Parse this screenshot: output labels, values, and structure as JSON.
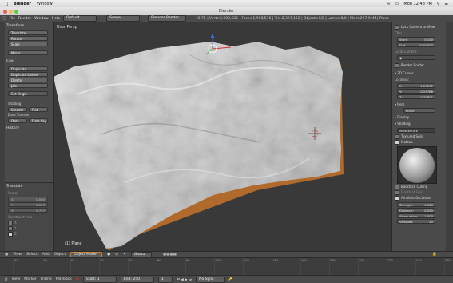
{
  "macbar": {
    "app": "Blender",
    "menu": "Window",
    "clock": "Mon 12:48 PM"
  },
  "window": {
    "title": "Blender"
  },
  "header": {
    "menus": [
      "File",
      "Render",
      "Window",
      "Help"
    ],
    "layout": "Default",
    "scene": "Scene",
    "engine": "Blender Render",
    "stats": "v2.75 | Verts:2,003,626 | Faces:1,998,576 | Tris:2,397,152 | Objects:0/2 | Lamps:0/0 | Mem:297.94M | Plane"
  },
  "toolshelf": {
    "transform_title": "Transform",
    "transform_buttons": [
      "Translate",
      "Rotate",
      "Scale",
      "Mirror"
    ],
    "edit_title": "Edit",
    "edit_buttons": [
      "Duplicate",
      "Duplicate Linked",
      "Delete",
      "Join"
    ],
    "set_origin": "Set Origin",
    "shading_title": "Shading",
    "smooth": "Smooth",
    "flat": "Flat",
    "data_transfer": "Data Transfer",
    "data": "Data",
    "data_lay": "Data Lay",
    "history_title": "History",
    "op_title": "Translate",
    "vector_label": "Vector",
    "vector": [
      {
        "axis": "X",
        "value": "0.000"
      },
      {
        "axis": "Y",
        "value": "0.000"
      },
      {
        "axis": "Z",
        "value": "0.737"
      }
    ],
    "constraint_label": "Constraint Axis",
    "constraints": [
      "X",
      "Y",
      "Z"
    ]
  },
  "viewport": {
    "label": "User Persp",
    "object": "(1) Plane"
  },
  "props": {
    "lock_camera": "Lock Camera to View",
    "clip_title": "Clip:",
    "clip_start_label": "Start:",
    "clip_start": "0.100",
    "clip_end_label": "End:",
    "clip_end": "1000.000",
    "local_camera": "Local Camera:",
    "render_border": "Render Border",
    "cursor_title": "3D Cursor",
    "location_label": "Location:",
    "cursor": [
      {
        "axis": "X:",
        "value": "1.25251"
      },
      {
        "axis": "Y:",
        "value": "0.24788"
      },
      {
        "axis": "Z:",
        "value": "0.32801"
      }
    ],
    "item_title": "Item",
    "item_name": "Plane",
    "display_title": "Display",
    "shading_title": "Shading",
    "shading_mode": "Multitexture",
    "textured_solid": "Textured Solid",
    "matcap": "Matcap",
    "backface": "Backface Culling",
    "depth_of_field": "Depth of Field",
    "ambient": "Ambient Occlusion",
    "ao": [
      {
        "label": "Strength:",
        "value": "1.000"
      },
      {
        "label": "Distance:",
        "value": "0.200"
      },
      {
        "label": "Attenuation:",
        "value": "1.000"
      },
      {
        "label": "Samples:",
        "value": "20"
      }
    ]
  },
  "viewheader": {
    "items": [
      "View",
      "Select",
      "Add",
      "Object"
    ],
    "mode": "Object Mode",
    "pivot": "Global"
  },
  "timeline": {
    "ticks": [
      "-40",
      "-20",
      "0",
      "20",
      "40",
      "60",
      "80",
      "100",
      "120",
      "140",
      "160",
      "180",
      "200",
      "220",
      "240",
      "260"
    ],
    "menus": [
      "View",
      "Marker",
      "Frame",
      "Playback"
    ],
    "start_label": "Start:",
    "start": "1",
    "end_label": "End:",
    "end": "250",
    "current": "1",
    "sync": "No Sync"
  },
  "colors": {
    "accent": "#e08a2c",
    "cursor": "#d03030"
  }
}
